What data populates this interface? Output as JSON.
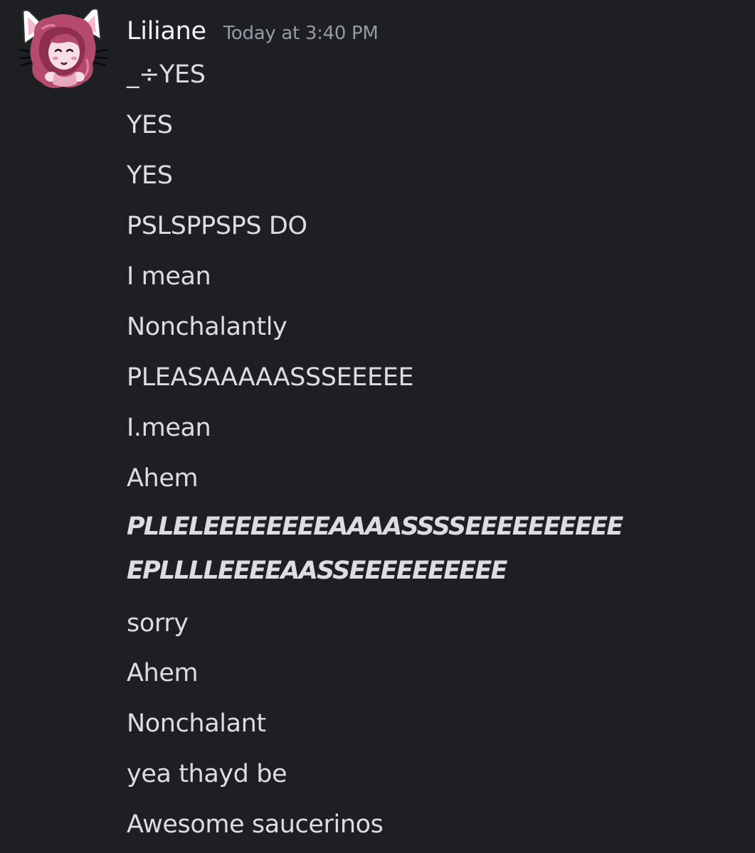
{
  "message": {
    "author": "Liliane",
    "timestamp": "Today at 3:40 PM",
    "lines": [
      {
        "text": "_÷YES",
        "style": "normal"
      },
      {
        "text": "YES",
        "style": "normal"
      },
      {
        "text": "YES",
        "style": "normal"
      },
      {
        "text": "PSLSPPSPS DO",
        "style": "normal"
      },
      {
        "text": "I mean",
        "style": "normal"
      },
      {
        "text": "Nonchalantly",
        "style": "normal"
      },
      {
        "text": "PLEASAAAAASSSEEEEE",
        "style": "normal"
      },
      {
        "text": "I.mean",
        "style": "normal"
      },
      {
        "text": "Ahem",
        "style": "normal"
      },
      {
        "text": "PLLELEEEEEEEEAAAASSSSEEEEEEEEEE",
        "style": "bold-italic"
      },
      {
        "text": "EPLLLLEEEEAASSEEEEEEEEEE",
        "style": "bold-italic"
      },
      {
        "text": "sorry",
        "style": "normal"
      },
      {
        "text": "Ahem",
        "style": "normal"
      },
      {
        "text": "Nonchalant",
        "style": "normal"
      },
      {
        "text": "yea thayd be",
        "style": "normal"
      },
      {
        "text": "Awesome saucerinos",
        "style": "normal"
      }
    ]
  },
  "avatar": {
    "icon": "cat-eared-anime-avatar-icon",
    "colors": {
      "hair": "#b44a6c",
      "ears": "#ffffff",
      "ear_inner": "#f4b9cf",
      "face": "#f6dfe4"
    }
  },
  "colors": {
    "background": "#1e1f22",
    "username": "#f2f3f5",
    "timestamp": "#949ba4",
    "text": "#dbdee1"
  }
}
